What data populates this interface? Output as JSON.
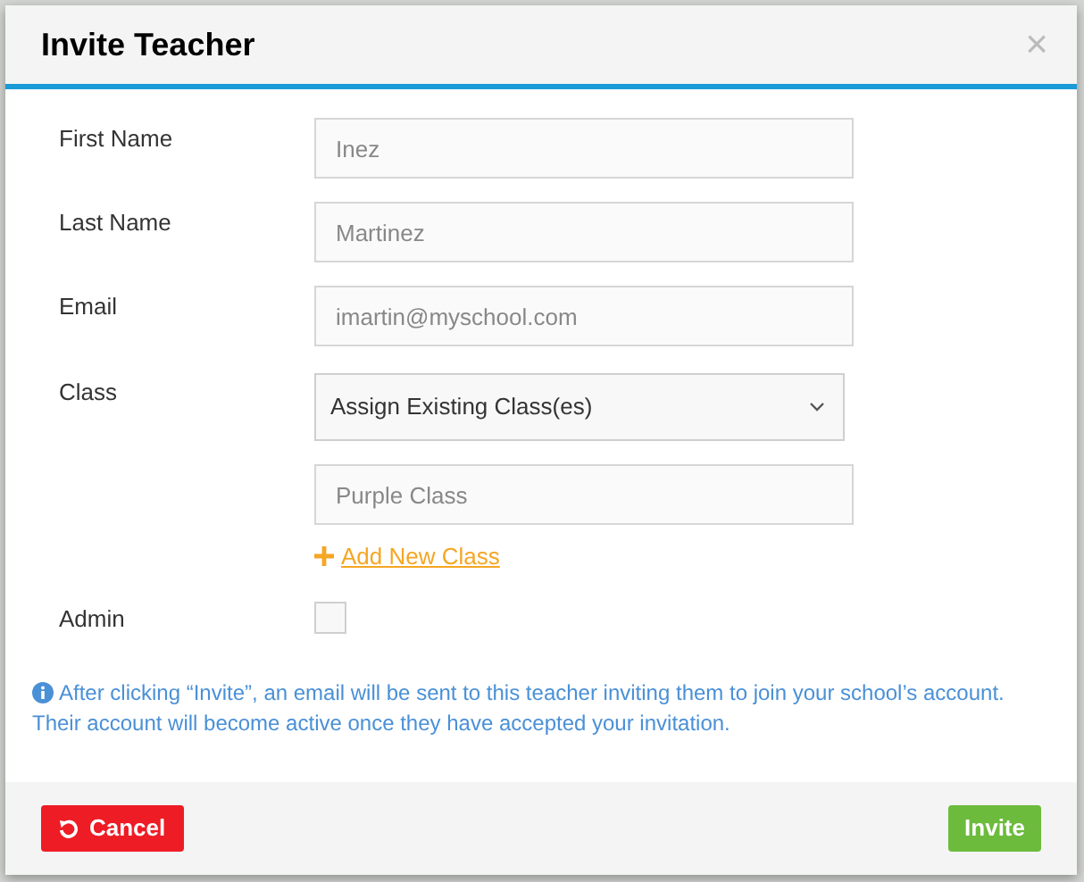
{
  "dialog": {
    "title": "Invite Teacher",
    "close": "×",
    "fields": [
      {
        "kind": "text",
        "label": "First Name",
        "value": "Inez"
      },
      {
        "kind": "text",
        "label": "Last Name",
        "value": "Martinez"
      },
      {
        "kind": "text",
        "label": "Email",
        "value": "imartin@myschool.com"
      },
      {
        "kind": "class",
        "label": "Class",
        "select": "Assign Existing Class(es)",
        "value": "Purple Class",
        "link": "Add New Class"
      },
      {
        "kind": "checkbox",
        "label": "Admin",
        "checked": false
      }
    ],
    "info": "After clicking “Invite”, an email will be sent to this teacher inviting them to join your school’s account. Their account will become active once they have accepted your invitation.",
    "buttons": [
      {
        "kind": "cancel",
        "label": "Cancel"
      },
      {
        "kind": "invite",
        "label": "Invite"
      }
    ]
  }
}
